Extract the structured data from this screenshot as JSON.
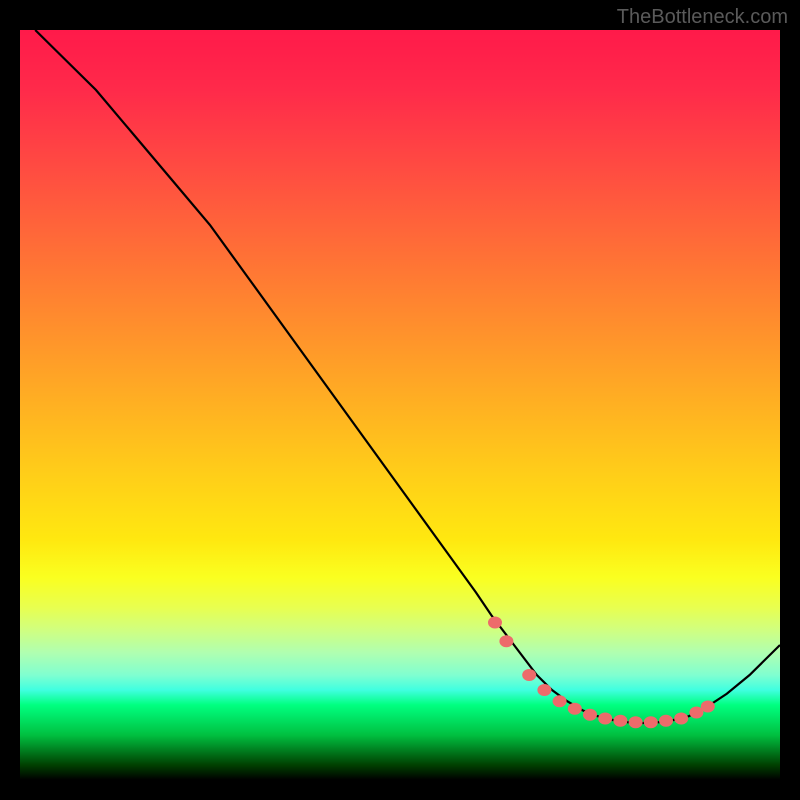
{
  "attribution": "TheBottleneck.com",
  "chart_data": {
    "type": "line",
    "title": "",
    "xlabel": "",
    "ylabel": "",
    "xlim": [
      0,
      100
    ],
    "ylim": [
      0,
      100
    ],
    "curve": {
      "x": [
        2,
        5,
        10,
        15,
        20,
        25,
        30,
        35,
        40,
        45,
        50,
        55,
        60,
        62,
        65,
        68,
        70,
        72,
        74,
        76,
        78,
        80,
        82,
        84,
        86,
        88,
        90,
        93,
        96,
        100
      ],
      "y": [
        100,
        97,
        92,
        86,
        80,
        74,
        67,
        60,
        53,
        46,
        39,
        32,
        25,
        22,
        18,
        14,
        12,
        10.5,
        9.3,
        8.5,
        8.0,
        7.7,
        7.6,
        7.7,
        8.0,
        8.5,
        9.5,
        11.5,
        14,
        18
      ]
    },
    "dots": {
      "x": [
        62.5,
        64,
        67,
        69,
        71,
        73,
        75,
        77,
        79,
        81,
        83,
        85,
        87,
        89,
        90.5
      ],
      "y": [
        21,
        18.5,
        14,
        12,
        10.5,
        9.5,
        8.7,
        8.2,
        7.9,
        7.7,
        7.7,
        7.9,
        8.2,
        9.0,
        9.8
      ]
    },
    "gradient_description": "vertical red-yellow-green bottleneck heatmap"
  }
}
